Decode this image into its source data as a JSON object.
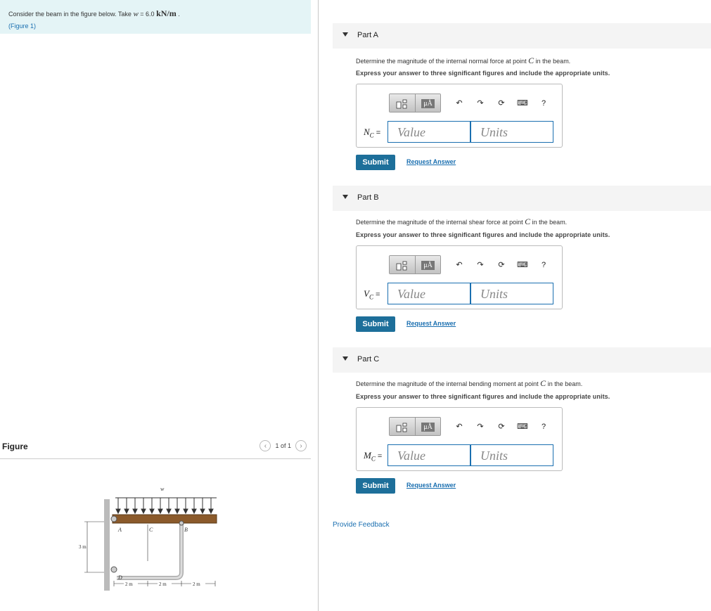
{
  "problem": {
    "text_before": "Consider the beam in the figure below. Take ",
    "var": "w",
    "equals": " = 6.0 ",
    "unit": "kN/m",
    "text_after": " .",
    "figure_link": "(Figure 1)"
  },
  "figure_panel": {
    "title": "Figure",
    "pager_text": "1 of 1",
    "prev_icon": "chevron-left-icon",
    "next_icon": "chevron-right-icon"
  },
  "figure": {
    "load_label": "w",
    "point_a": "A",
    "point_b": "B",
    "point_c": "C",
    "point_d": "D",
    "height_label": "3 m",
    "dim_1": "2 m",
    "dim_2": "2 m",
    "dim_3": "2 m"
  },
  "parts": [
    {
      "title": "Part A",
      "question_before": "Determine the magnitude of the internal normal force at point ",
      "point": "C",
      "question_after": " in the beam.",
      "instruction": "Express your answer to three significant figures and include the appropriate units.",
      "var_symbol": "N",
      "var_sub": "C",
      "value_placeholder": "Value",
      "units_placeholder": "Units",
      "submit_label": "Submit",
      "request_label": "Request Answer"
    },
    {
      "title": "Part B",
      "question_before": "Determine the magnitude of the internal shear force at point ",
      "point": "C",
      "question_after": " in the beam.",
      "instruction": "Express your answer to three significant figures and include the appropriate units.",
      "var_symbol": "V",
      "var_sub": "C",
      "value_placeholder": "Value",
      "units_placeholder": "Units",
      "submit_label": "Submit",
      "request_label": "Request Answer"
    },
    {
      "title": "Part C",
      "question_before": "Determine the magnitude of the internal bending moment at point ",
      "point": "C",
      "question_after": " in the beam.",
      "instruction": "Express your answer to three significant figures and include the appropriate units.",
      "var_symbol": "M",
      "var_sub": "C",
      "value_placeholder": "Value",
      "units_placeholder": "Units",
      "submit_label": "Submit",
      "request_label": "Request Answer"
    }
  ],
  "toolbar": {
    "mu_label": "μÅ",
    "templates_icon": "templates-icon",
    "units_icon": "mu-units-icon",
    "undo_icon": "undo-icon",
    "redo_icon": "redo-icon",
    "reset_icon": "reset-icon",
    "keyboard_icon": "keyboard-icon",
    "help_label": "?"
  },
  "feedback_label": "Provide Feedback"
}
